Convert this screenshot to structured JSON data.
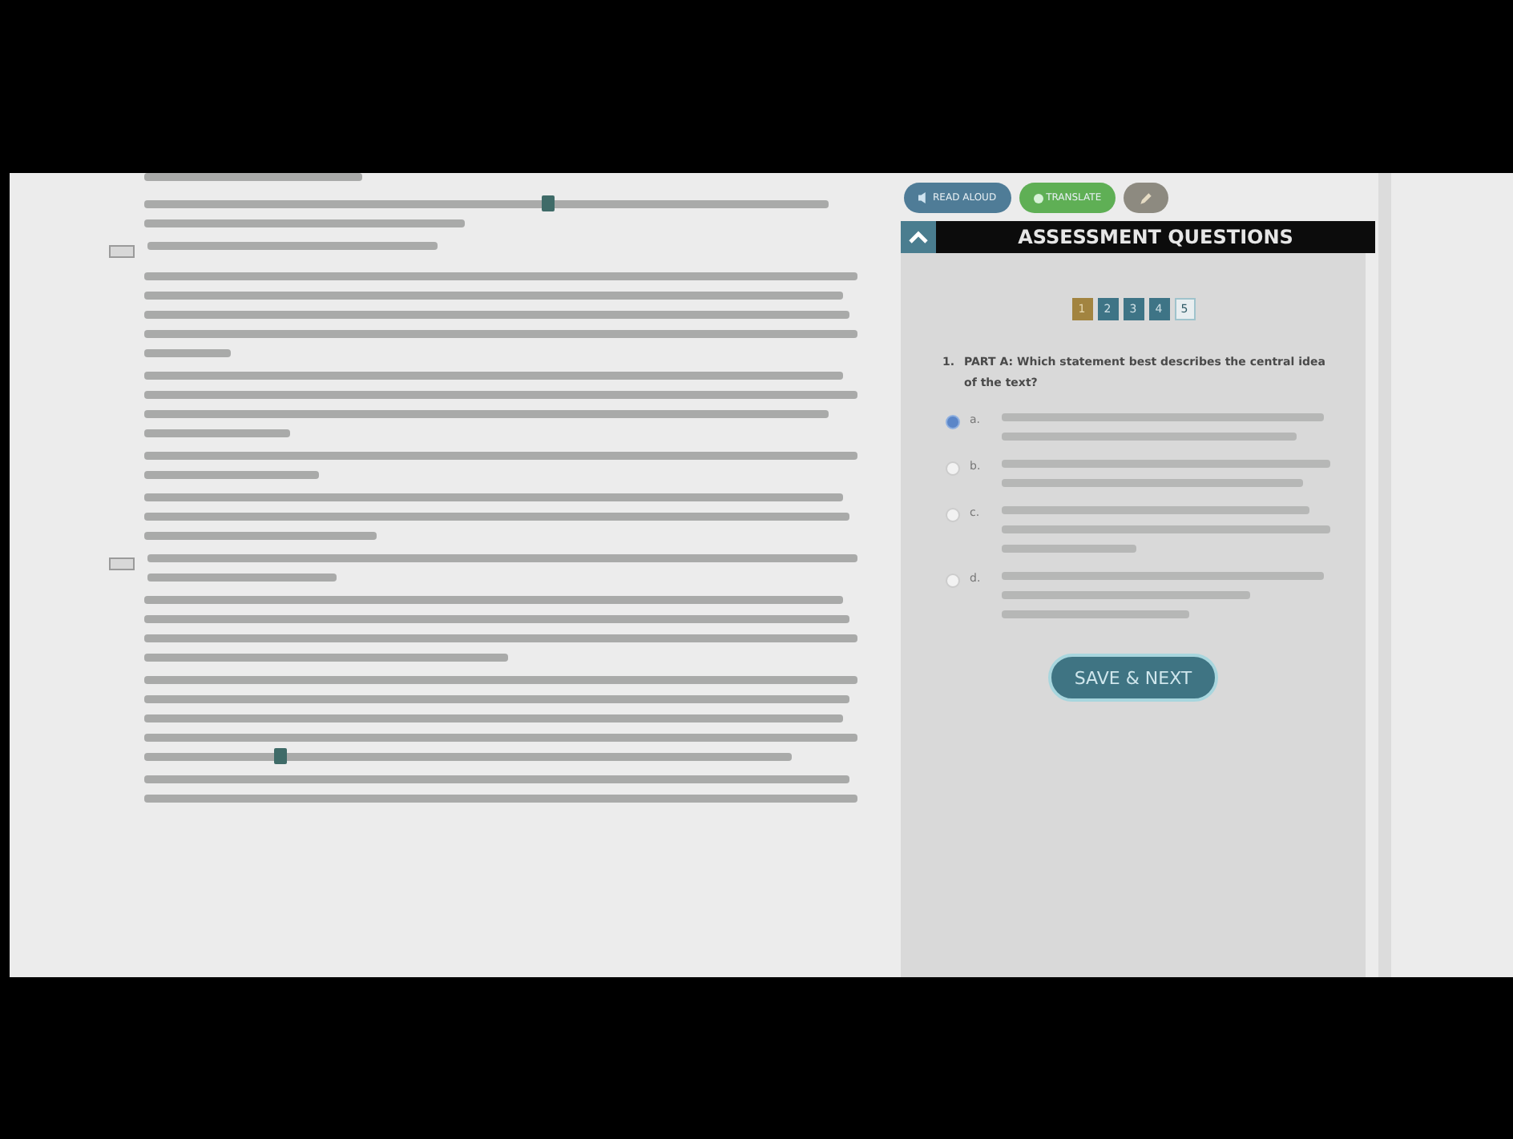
{
  "toolbar": {
    "buttons": [
      {
        "kind": "read",
        "label": "READ ALOUD"
      },
      {
        "kind": "translate",
        "label": "TRANSLATE"
      },
      {
        "kind": "annotate"
      }
    ]
  },
  "panel": {
    "title": "ASSESSMENT QUESTIONS",
    "expanded": true,
    "pages": [
      {
        "label": "1",
        "selected": true,
        "answered": true
      },
      {
        "label": "2",
        "selected": false,
        "answered": true
      },
      {
        "label": "3",
        "selected": false,
        "answered": true
      },
      {
        "label": "4",
        "selected": false,
        "answered": true
      },
      {
        "label": "5",
        "selected": false,
        "answered": false
      }
    ],
    "question": {
      "number": "1.",
      "text": "PART A: Which statement best describes the central idea of the text?"
    },
    "options": [
      {
        "letter": "a.",
        "selected": true
      },
      {
        "letter": "b.",
        "selected": false
      },
      {
        "letter": "c.",
        "selected": false
      },
      {
        "letter": "d.",
        "selected": false
      }
    ],
    "submit": "SAVE & NEXT"
  }
}
